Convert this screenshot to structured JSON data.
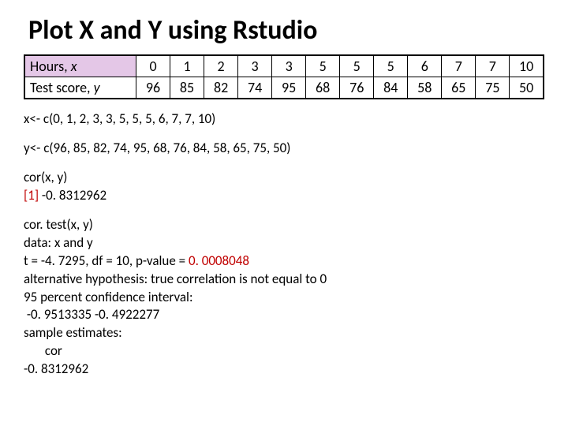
{
  "title": "Plot X and Y using Rstudio",
  "table": {
    "row1_label_prefix": "Hours, ",
    "row1_label_var": "x",
    "row2_label_prefix": "Test score, ",
    "row2_label_var": "y",
    "x": [
      "0",
      "1",
      "2",
      "3",
      "3",
      "5",
      "5",
      "5",
      "6",
      "7",
      "7",
      "10"
    ],
    "y": [
      "96",
      "85",
      "82",
      "74",
      "95",
      "68",
      "76",
      "84",
      "58",
      "65",
      "75",
      "50"
    ]
  },
  "lines": {
    "x_assign": "x<- c(0, 1, 2, 3, 3, 5, 5, 5, 6, 7, 7, 10)",
    "y_assign": "y<- c(96,  85, 82, 74, 95, 68, 76, 84, 58, 65, 75, 50)",
    "cor_call": "cor(x, y)",
    "cor_out_prefix": "[1] ",
    "cor_out_val": "-0. 8312962",
    "cortest_call": "cor. test(x, y)",
    "cortest_data": "data:  x and y",
    "cortest_t_prefix": "t = -4. 7295, df = 10, p-value = ",
    "cortest_pval": "0. 0008048",
    "cortest_alt": "alternative hypothesis: true correlation is not equal to 0",
    "cortest_ci_label": "95 percent confidence interval:",
    "cortest_ci_vals": " -0. 9513335 -0. 4922277",
    "cortest_est_label": "sample estimates:",
    "cortest_est_cor": "       cor",
    "cortest_est_val": "-0. 8312962"
  }
}
